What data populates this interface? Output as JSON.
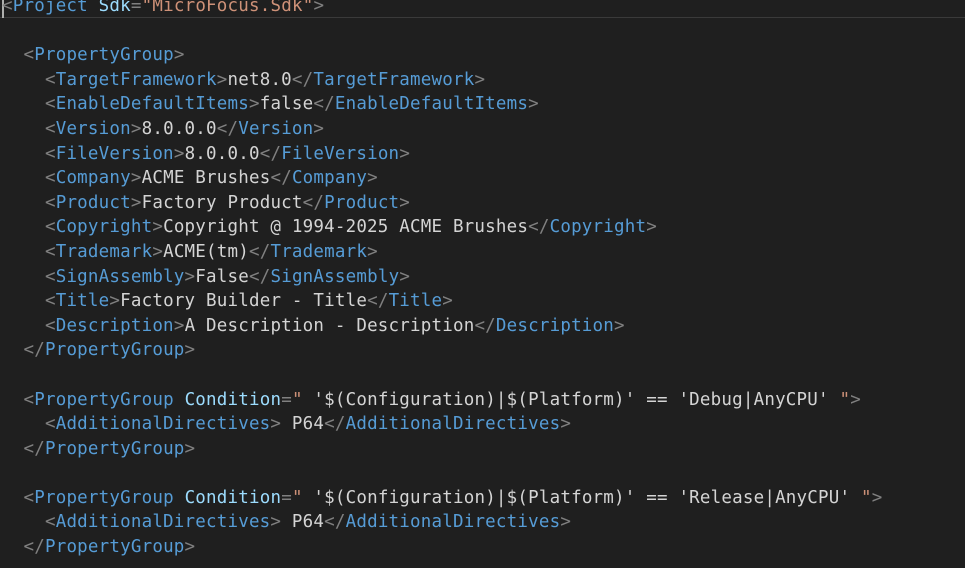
{
  "project": {
    "tag": "Project",
    "attr": "Sdk",
    "value": "MicroFocus.Sdk"
  },
  "group1": {
    "tag": "PropertyGroup",
    "props": [
      {
        "tag": "TargetFramework",
        "value": "net8.0"
      },
      {
        "tag": "EnableDefaultItems",
        "value": "false"
      },
      {
        "tag": "Version",
        "value": "8.0.0.0"
      },
      {
        "tag": "FileVersion",
        "value": "8.0.0.0"
      },
      {
        "tag": "Company",
        "value": "ACME Brushes"
      },
      {
        "tag": "Product",
        "value": "Factory Product"
      },
      {
        "tag": "Copyright",
        "value": "Copyright @ 1994-2025 ACME Brushes"
      },
      {
        "tag": "Trademark",
        "value": "ACME(tm)"
      },
      {
        "tag": "SignAssembly",
        "value": "False"
      },
      {
        "tag": "Title",
        "value": "Factory Builder - Title"
      },
      {
        "tag": "Description",
        "value": "A Description - Description"
      }
    ]
  },
  "group2": {
    "tag": "PropertyGroup",
    "attr": "Condition",
    "condition": " '$(Configuration)|$(Platform)' == 'Debug|AnyCPU' ",
    "prop_tag": "AdditionalDirectives",
    "prop_value": " P64"
  },
  "group3": {
    "tag": "PropertyGroup",
    "attr": "Condition",
    "condition": " '$(Configuration)|$(Platform)' == 'Release|AnyCPU' ",
    "prop_tag": "AdditionalDirectives",
    "prop_value": " P64"
  },
  "colors": {
    "background": "#1f1f1f",
    "tag": "#569cd6",
    "attribute": "#9cdcfe",
    "string": "#ce9178",
    "text": "#d4d4d4",
    "punctuation": "#808080"
  }
}
